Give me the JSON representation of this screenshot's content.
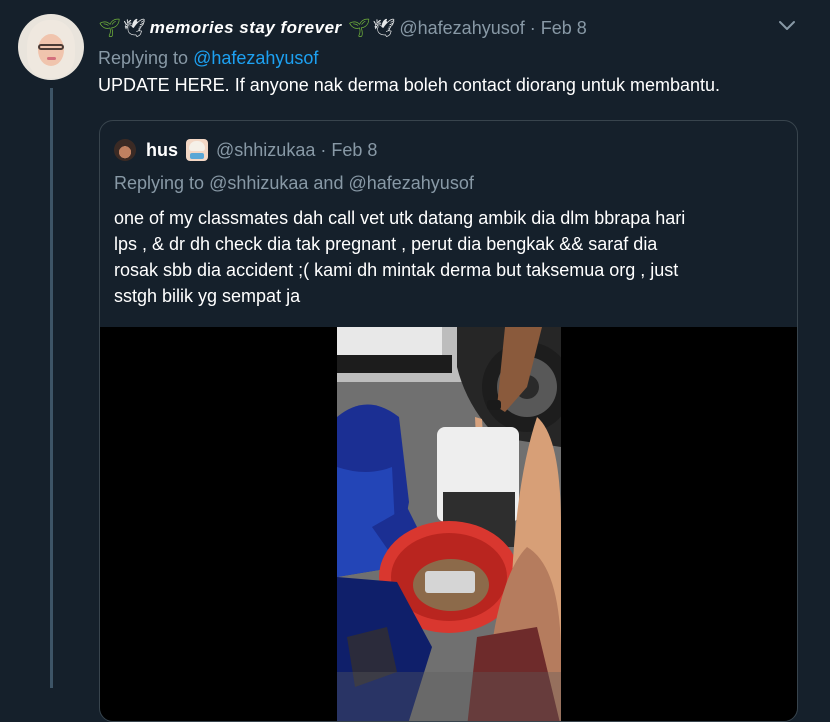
{
  "tweet": {
    "display_name": "memories stay forever",
    "handle": "@hafezahyusof",
    "date": "Feb 8",
    "replying_prefix": "Replying to",
    "replying_to": "@hafezahyusof",
    "text": "UPDATE HERE. If anyone nak derma boleh contact diorang untuk membantu."
  },
  "quoted": {
    "display_name": "hus",
    "handle": "@shhizukaa",
    "date": "Feb 8",
    "replying_prefix": "Replying to",
    "replying_first": "@shhizukaa",
    "replying_and": "and",
    "replying_second": "@hafezahyusof",
    "lines": [
      "one of my classmates dah call vet utk datang ambik dia dlm bbrapa hari",
      "lps , & dr dh check dia tak pregnant , perut dia bengkak && saraf dia",
      "rosak sbb dia accident ;( kami dh mintak derma but taksemua org , just",
      "sstgh bilik yg sempat ja"
    ]
  },
  "icons": {
    "sprout": "seedling-emoji",
    "dove": "dove-emoji",
    "menu": "chevron-down-icon"
  },
  "colors": {
    "background": "#15202b",
    "link": "#1da1f2",
    "secondary_text": "#8899a6",
    "border": "#38444d"
  }
}
